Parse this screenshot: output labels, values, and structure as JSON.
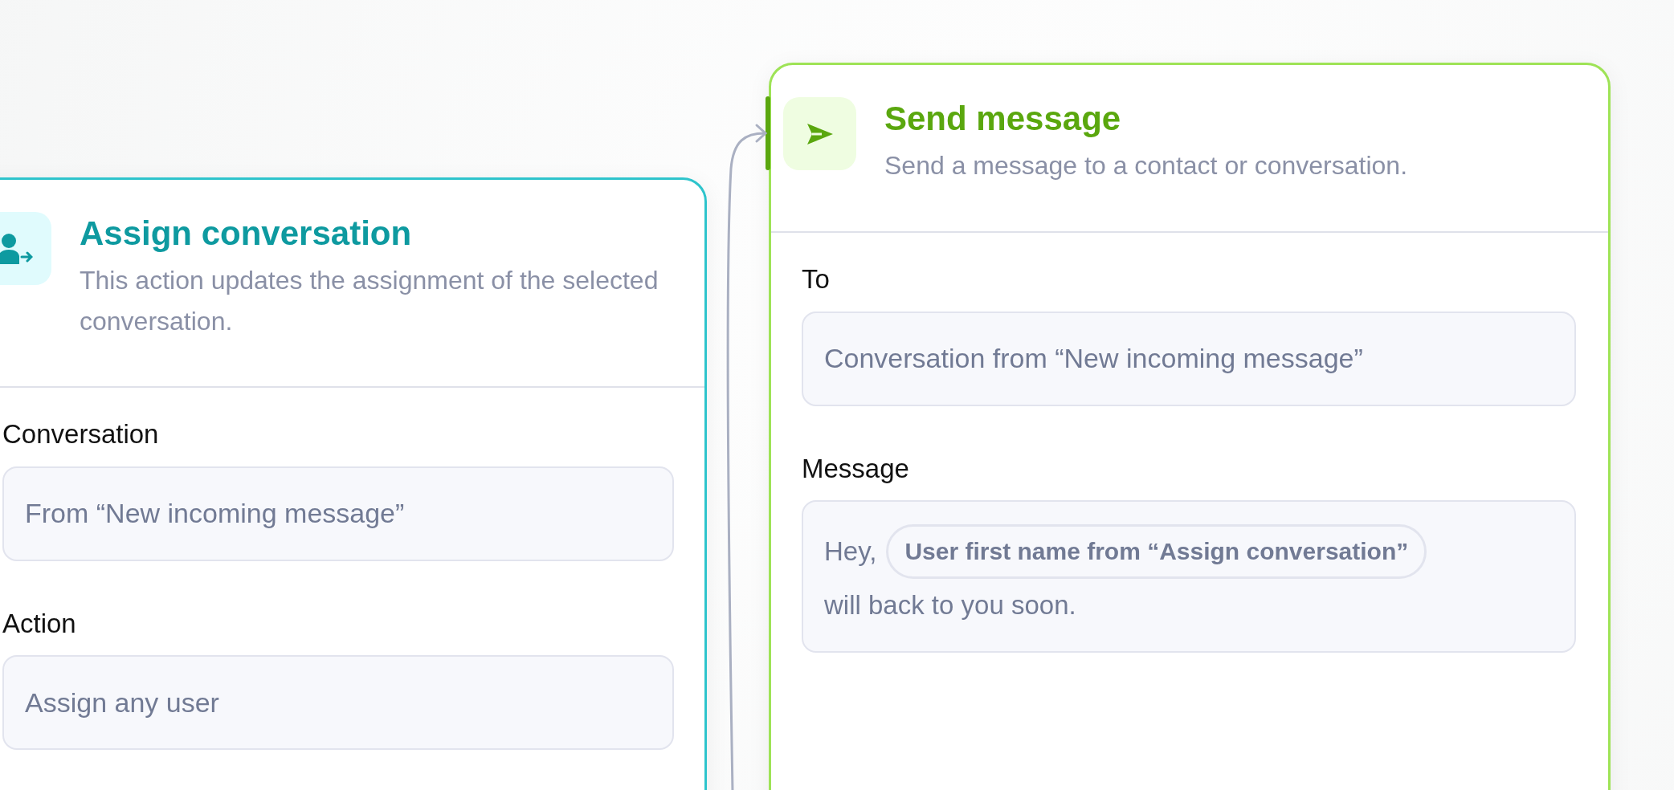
{
  "nodes": [
    {
      "kind": "assign",
      "color": "#0e9aa0",
      "title": "Assign conversation",
      "description": "This action updates the assignment of the selected conversation.",
      "fields": [
        {
          "label": "Conversation",
          "value": "From “New incoming message”"
        },
        {
          "label": "Action",
          "value": "Assign any user"
        }
      ]
    },
    {
      "kind": "send",
      "color": "#5aa70e",
      "title": "Send message",
      "description": "Send a message to a contact or conversation.",
      "fields": [
        {
          "label": "To",
          "value": "Conversation from “New incoming message”"
        }
      ],
      "message": {
        "label": "Message",
        "parts": [
          {
            "kind": "text",
            "text": "Hey,"
          },
          {
            "kind": "variable",
            "text": "User first name from “Assign conversation”"
          },
          {
            "kind": "text",
            "text": "will back to you soon."
          }
        ]
      }
    }
  ]
}
